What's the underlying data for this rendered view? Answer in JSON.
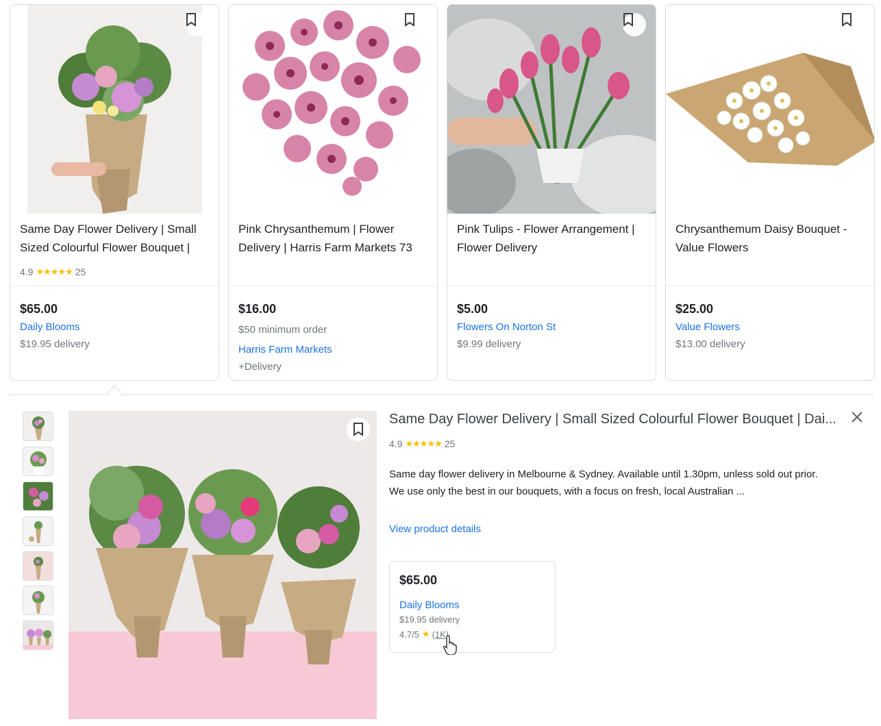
{
  "cards": [
    {
      "title": "Same Day Flower Delivery | Small Sized Colourful Flower Bouquet |",
      "rating": "4.9",
      "reviews": "25",
      "price": "$65.00",
      "seller": "Daily Blooms",
      "delivery": "$19.95 delivery"
    },
    {
      "title": "Pink Chrysanthemum | Flower Delivery | Harris Farm Markets 73",
      "price": "$16.00",
      "min_order": "$50 minimum order",
      "seller": "Harris Farm Markets",
      "delivery": "+Delivery"
    },
    {
      "title": "Pink Tulips - Flower Arrangement | Flower Delivery",
      "price": "$5.00",
      "seller": "Flowers On Norton St",
      "delivery": "$9.99 delivery"
    },
    {
      "title": "Chrysanthemum Daisy Bouquet - Value Flowers",
      "price": "$25.00",
      "seller": "Value Flowers",
      "delivery": "$13.00 delivery"
    }
  ],
  "stars": "★★★★★",
  "detail": {
    "title": "Same Day Flower Delivery | Small Sized Colourful Flower Bouquet | Dai...",
    "rating": "4.9",
    "reviews": "25",
    "description_1": "Same day flower delivery in Melbourne & Sydney. Available until 1.30pm, unless sold out prior.",
    "description_2": "We use only the best in our bouquets, with a focus on fresh, local Australian ...",
    "view_link": "View product details",
    "offer": {
      "price": "$65.00",
      "seller": "Daily Blooms",
      "delivery": "$19.95 delivery",
      "seller_rating": "4.7/5",
      "star": "★",
      "rating_count": "(1K)"
    },
    "thumbnail_count": 7
  },
  "colors": {
    "link": "#1a73e8",
    "star": "#fbbc04",
    "border": "#dadce0",
    "muted": "#70757a"
  },
  "icons": [
    "bookmark-icon",
    "close-icon",
    "star-icon",
    "hand-cursor-icon"
  ]
}
